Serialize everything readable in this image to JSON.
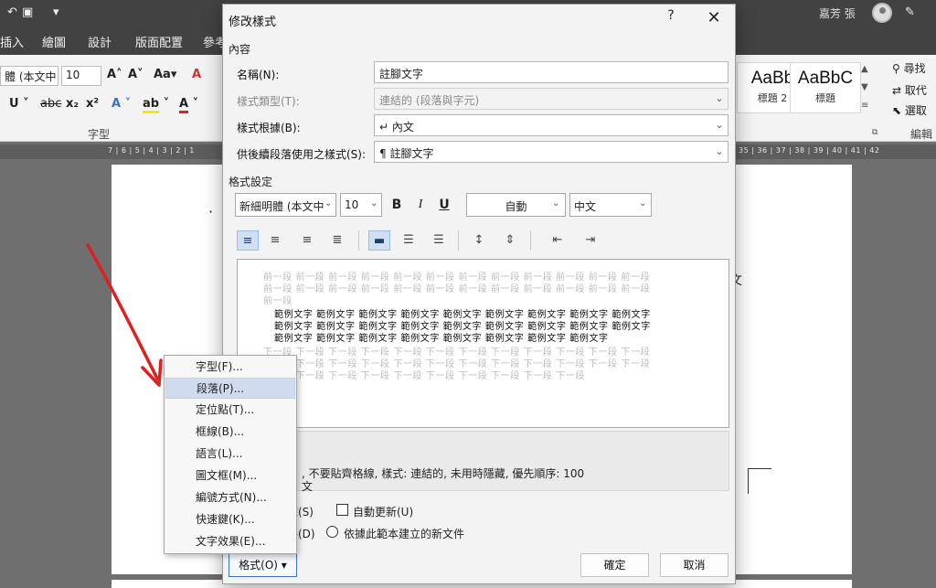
{
  "word": {
    "user_name": "嘉芳 張",
    "tabs": [
      "插入",
      "繪圖",
      "設計",
      "版面配置",
      "參考"
    ],
    "font_name": "體 (本文中",
    "font_size": "10",
    "font_group_label": "字型",
    "styles": [
      {
        "preview": "AaBb",
        "name": "標題 2"
      },
      {
        "preview": "AaBbC",
        "name": "標題"
      }
    ],
    "editing": {
      "find": "尋找",
      "replace": "取代",
      "select": "選取",
      "group_label": "編輯"
    },
    "ruler_left": "7 | 6 | 5 | 4 | 3 | 2 | 1",
    "ruler_right": "35 | 36 | 37 | 38 | 39 | 40 | 41 | 42",
    "page_char": "文"
  },
  "dialog": {
    "title": "修改樣式",
    "help": "?",
    "close": "✕",
    "section_properties": "內容",
    "name_label": "名稱(N):",
    "name_value": "註腳文字",
    "type_label": "樣式類型(T):",
    "type_value": "連結的 (段落與字元)",
    "based_label": "樣式根據(B):",
    "based_value": "↵ 內文",
    "following_label": "供後續段落使用之樣式(S):",
    "following_value": "¶ 註腳文字",
    "section_formatting": "格式設定",
    "font_value": "新細明體 (本文中",
    "size_value": "10",
    "bold": "B",
    "italic": "I",
    "underline": "U",
    "color_value": "自動",
    "script_value": "中文",
    "preview": {
      "prev_lines": [
        "前一段 前一段 前一段 前一段 前一段 前一段 前一段 前一段 前一段 前一段 前一段 前一段",
        "前一段 前一段 前一段 前一段 前一段 前一段 前一段 前一段 前一段 前一段 前一段 前一段",
        "前一段"
      ],
      "sample_lines": [
        "範例文字 範例文字 範例文字 範例文字 範例文字 範例文字 範例文字 範例文字 範例文字",
        "範例文字 範例文字 範例文字 範例文字 範例文字 範例文字 範例文字 範例文字 範例文字",
        "範例文字 範例文字 範例文字 範例文字 範例文字 範例文字 範例文字 範例文字"
      ],
      "next_lines": [
        "下一段 下一段 下一段 下一段 下一段 下一段 下一段 下一段 下一段 下一段 下一段 下一段",
        "下一段 下一段 下一段 下一段 下一段 下一段 下一段 下一段 下一段 下一段 下一段 下一段",
        "下一段 下一段 下一段 下一段 下一段 下一段 下一段 下一段 下一段 下一段"
      ]
    },
    "description_line1": ", 不要貼齊格線, 樣式: 連結的, 未用時隱藏, 優先順序: 100",
    "description_line2": "文",
    "add_gallery": "庫(S)",
    "auto_update": "自動更新(U)",
    "only_this_doc": "件(D)",
    "new_docs": "依據此範本建立的新文件",
    "format_button": "格式(O) ▾",
    "ok": "確定",
    "cancel": "取消"
  },
  "format_menu": {
    "items": [
      "字型(F)...",
      "段落(P)...",
      "定位點(T)...",
      "框線(B)...",
      "語言(L)...",
      "圖文框(M)...",
      "編號方式(N)...",
      "快速鍵(K)...",
      "文字效果(E)..."
    ],
    "hover_index": 1
  },
  "annotation_color": "#e02020"
}
